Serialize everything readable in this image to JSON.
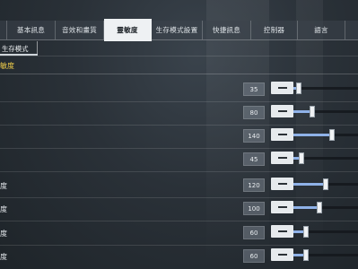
{
  "tabs": [
    {
      "label": "",
      "active": false
    },
    {
      "label": "基本訊息",
      "active": false
    },
    {
      "label": "音效和畫質",
      "active": false
    },
    {
      "label": "靈敏度",
      "active": true
    },
    {
      "label": "生存模式設置",
      "active": false
    },
    {
      "label": "快捷訊息",
      "active": false
    },
    {
      "label": "控制器",
      "active": false
    },
    {
      "label": "語言",
      "active": false
    },
    {
      "label": "",
      "active": false
    }
  ],
  "subtab": {
    "label": "生存模式"
  },
  "section": {
    "title": "敏度"
  },
  "sliders": [
    {
      "label": "",
      "value": "35",
      "fill": 0.08
    },
    {
      "label": "",
      "value": "80",
      "fill": 0.29
    },
    {
      "label": "",
      "value": "140",
      "fill": 0.6
    },
    {
      "label": "",
      "value": "45",
      "fill": 0.12
    },
    {
      "label": "度",
      "value": "120",
      "fill": 0.5
    },
    {
      "label": "度",
      "value": "100",
      "fill": 0.4
    },
    {
      "label": "度",
      "value": "60",
      "fill": 0.2
    },
    {
      "label": "度",
      "value": "60",
      "fill": 0.2
    }
  ]
}
